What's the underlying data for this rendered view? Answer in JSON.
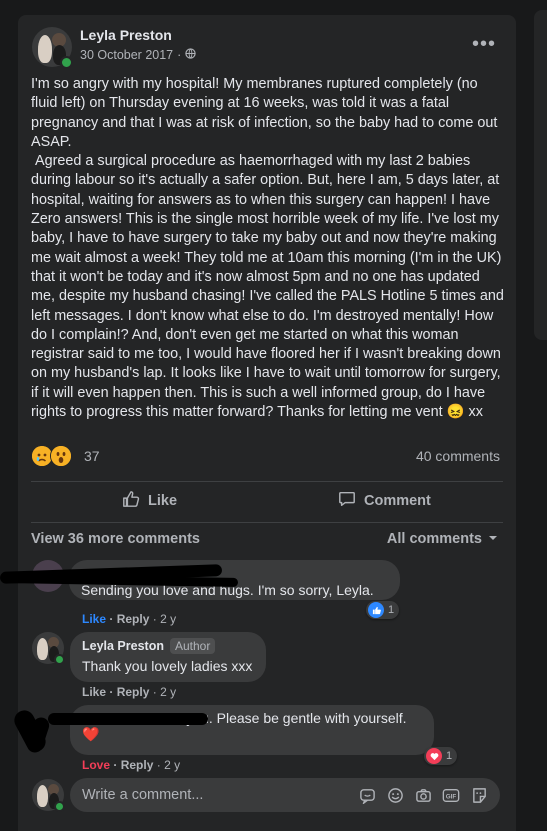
{
  "post": {
    "author": "Leyla Preston",
    "date": "30 October 2017",
    "separator": "·",
    "privacy_icon": "globe-icon",
    "menu_label": "•••",
    "text": "I'm so angry with my hospital! My membranes ruptured completely (no fluid left) on Thursday evening at 16 weeks, was told it was a fatal pregnancy and that I was at risk of infection, so the baby had to come out ASAP.\n Agreed a surgical procedure as haemorrhaged with my last 2 babies during labour so it's actually a safer option. But, here I am, 5 days later, at hospital, waiting for answers as to when this surgery can happen! I have Zero answers! This is the single most horrible week of my life. I've lost my baby, I have to have surgery to take my baby out and now they're making me wait almost a week! They told me at 10am this morning (I'm in the UK) that it won't be today and it's now almost 5pm and no one has updated me, despite my husband chasing! I've called the PALS Hotline 5 times and left messages. I don't know what else to do. I'm destroyed mentally! How do I complain!? And, don't even get me started on what this woman registrar said to me too, I would have floored her if I wasn't breaking down on my husband's lap. It looks like I have to wait until tomorrow for surgery, if it will even happen then. This is such a well informed group, do I have rights to progress this matter forward? Thanks for letting me vent 😖 xx",
    "reaction_count": "37",
    "comment_count": "40 comments"
  },
  "actions": {
    "like_label": "Like",
    "comment_label": "Comment"
  },
  "comments_header": {
    "view_more": "View 36 more comments",
    "sort_label": "All comments"
  },
  "comments": [
    {
      "author": "",
      "text": "Sending you love and hugs. I'm so sorry, Leyla.",
      "action": "Like",
      "reply": "Reply",
      "time": "2 y",
      "reaction_count": "1"
    },
    {
      "author": "Leyla Preston",
      "badge": "Author",
      "text": "Thank you lovely ladies xxx",
      "action": "Like",
      "reply": "Reply",
      "time": "2 y"
    },
    {
      "author": "",
      "text": "So much love to you. Please be gentle with yourself. ❤️",
      "action": "Love",
      "reply": "Reply",
      "time": "2 y",
      "reaction_count": "1"
    }
  ],
  "composer": {
    "placeholder": "Write a comment...",
    "icons": [
      "sticker-icon",
      "emoji-icon",
      "camera-icon",
      "gif-icon",
      "sticker-face-icon"
    ]
  },
  "colors": {
    "background": "#18191a",
    "card": "#242526",
    "bubble": "#3a3b3c",
    "like_blue": "#2d88ff",
    "love_red": "#f33e58",
    "online_green": "#31a24c"
  }
}
